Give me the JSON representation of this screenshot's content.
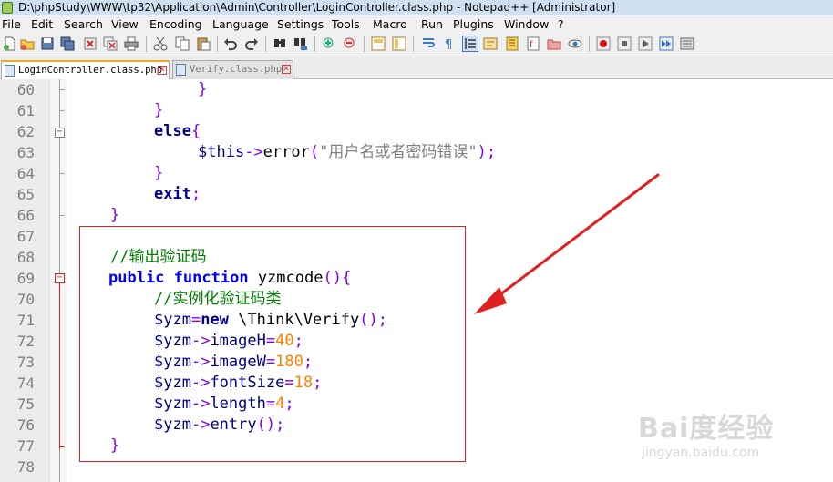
{
  "window": {
    "title": "D:\\phpStudy\\WWW\\tp32\\Application\\Admin\\Controller\\LoginController.class.php - Notepad++ [Administrator]"
  },
  "menu": [
    "File",
    "Edit",
    "Search",
    "View",
    "Encoding",
    "Language",
    "Settings",
    "Tools",
    "Macro",
    "Run",
    "Plugins",
    "Window",
    "?"
  ],
  "toolbar_icons": [
    "new-icon",
    "open-icon",
    "save-icon",
    "save-all-icon",
    "close-icon",
    "close-all-icon",
    "print-icon",
    "cut-icon",
    "copy-icon",
    "paste-icon",
    "undo-icon",
    "redo-icon",
    "find-icon",
    "replace-icon",
    "zoom-in-icon",
    "zoom-out-icon",
    "sync-v-icon",
    "sync-h-icon",
    "word-wrap-icon",
    "show-all-chars-icon",
    "indent-guide-icon",
    "user-lang-icon",
    "doc-map-icon",
    "function-list-icon",
    "folder-workspace-icon",
    "monitoring-icon",
    "record-macro-icon",
    "stop-macro-icon",
    "play-macro-icon",
    "run-macro-multiple-icon",
    "save-macro-icon"
  ],
  "tabs": [
    {
      "label": "LoginController.class.php",
      "active": true
    },
    {
      "label": "Verify.class.php",
      "active": false
    }
  ],
  "editor": {
    "current_line": "73",
    "lines": [
      {
        "no": "60",
        "fold": "end"
      },
      {
        "no": "61",
        "fold": "end"
      },
      {
        "no": "62",
        "fold": "box"
      },
      {
        "no": "63",
        "fold": ""
      },
      {
        "no": "64",
        "fold": "end"
      },
      {
        "no": "65",
        "fold": ""
      },
      {
        "no": "66",
        "fold": "end"
      },
      {
        "no": "67",
        "fold": ""
      },
      {
        "no": "68",
        "fold": ""
      },
      {
        "no": "69",
        "fold": "box-red"
      },
      {
        "no": "70",
        "fold": ""
      },
      {
        "no": "71",
        "fold": ""
      },
      {
        "no": "72",
        "fold": ""
      },
      {
        "no": "73",
        "fold": ""
      },
      {
        "no": "74",
        "fold": ""
      },
      {
        "no": "75",
        "fold": ""
      },
      {
        "no": "76",
        "fold": ""
      },
      {
        "no": "77",
        "fold": "end-red"
      },
      {
        "no": "78",
        "fold": ""
      }
    ],
    "code": {
      "l60_brace": "}",
      "l61_brace": "}",
      "l62_else": "else",
      "l62_brace": "{",
      "l63_var": "$this",
      "l63_arrow": "->",
      "l63_method": "error",
      "l63_open": "(",
      "l63_string": "\"用户名或者密码错误\"",
      "l63_close": ");",
      "l64_brace": "}",
      "l65_exit": "exit",
      "l65_semi": ";",
      "l66_brace": "}",
      "l68_comment": "//输出验证码",
      "l69_public": "public",
      "l69_function": "function",
      "l69_name": "yzmcode",
      "l69_paren": "(){",
      "l70_comment": "//实例化验证码类",
      "l71_var": "$yzm",
      "l71_eq": "=",
      "l71_new": "new",
      "l71_class": "\\Think\\Verify",
      "l71_end": "();",
      "l72_var": "$yzm",
      "l72_arrow": "->",
      "l72_prop": "imageH",
      "l72_eq": "=",
      "l72_num": "40",
      "l72_semi": ";",
      "l73_var": "$yzm",
      "l73_arrow": "->",
      "l73_prop": "imageW",
      "l73_eq": "=",
      "l73_num": "180",
      "l73_semi": ";",
      "l74_var": "$yzm",
      "l74_arrow": "->",
      "l74_prop": "fontSize",
      "l74_eq": "=",
      "l74_num": "18",
      "l74_semi": ";",
      "l75_var": "$yzm",
      "l75_arrow": "->",
      "l75_prop": "length",
      "l75_eq": "=",
      "l75_num": "4",
      "l75_semi": ";",
      "l76_var": "$yzm",
      "l76_arrow": "->",
      "l76_prop": "entry",
      "l76_end": "();",
      "l77_brace": "}"
    }
  },
  "annotation": {
    "box_color": "#e02020",
    "arrow_color": "#e02020"
  },
  "watermark": {
    "logo": "Bai度经验",
    "url": "jingyan.baidu.com"
  }
}
